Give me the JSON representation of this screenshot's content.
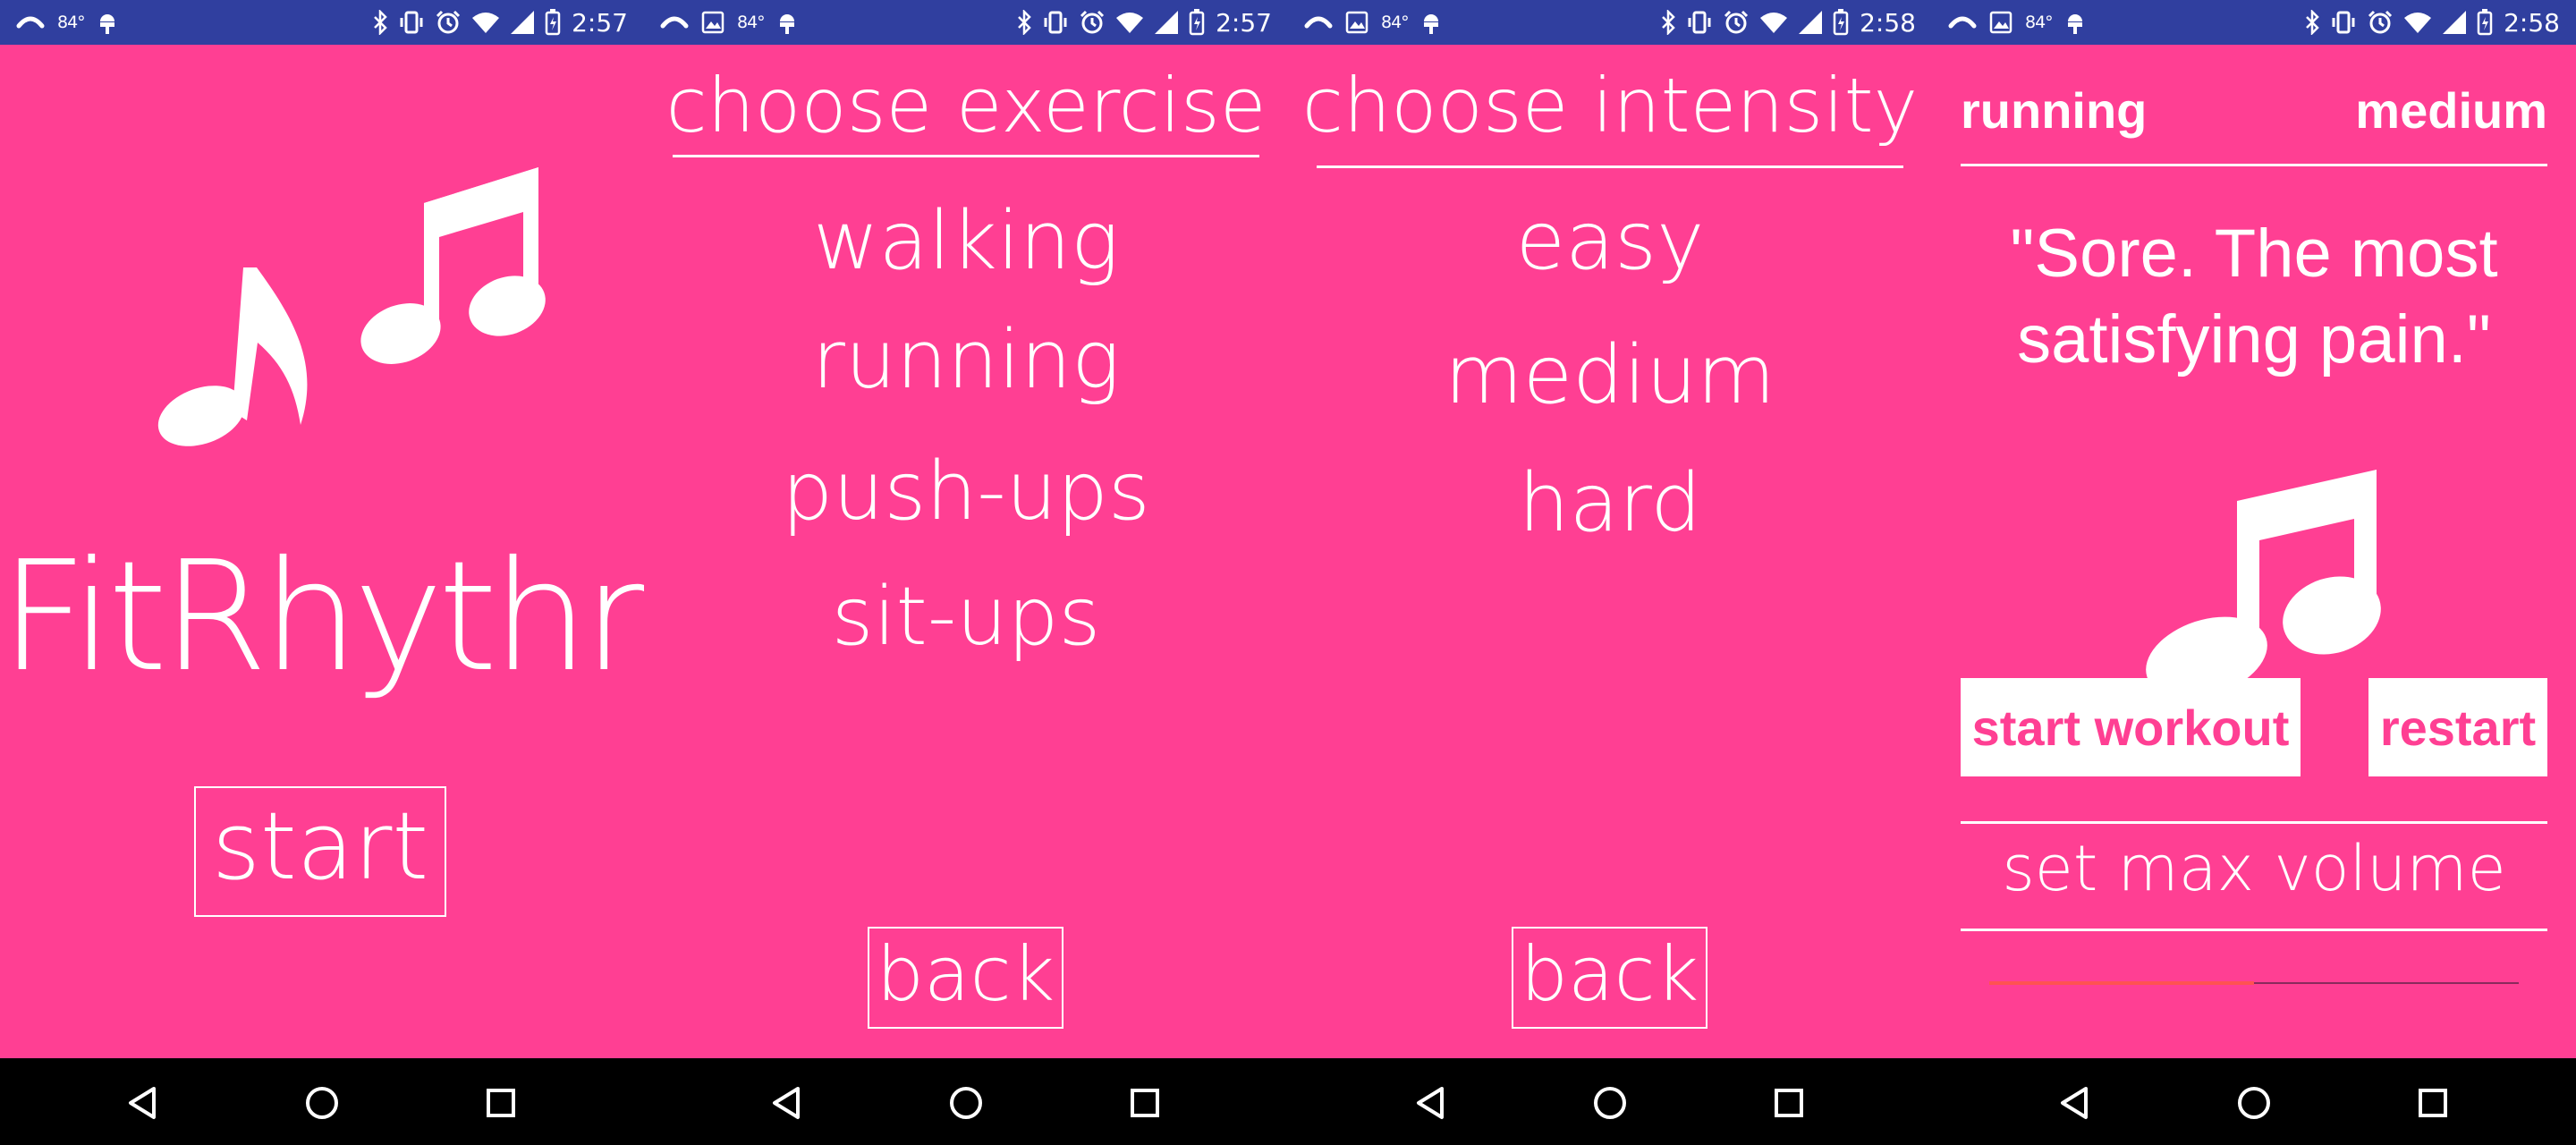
{
  "colors": {
    "background": "#FF3F93",
    "status_bar": "#303F9F",
    "nav_bar": "#000000",
    "foreground": "#FFFFFF"
  },
  "status_bars": [
    {
      "temperature": "84°",
      "time": "2:57"
    },
    {
      "temperature": "84°",
      "time": "2:57"
    },
    {
      "temperature": "84°",
      "time": "2:58"
    },
    {
      "temperature": "84°",
      "time": "2:58"
    }
  ],
  "home": {
    "app_name": "FitRhythm",
    "start_label": "start",
    "icon": "music-notes-icon"
  },
  "exercise": {
    "title": "choose exercise",
    "options": [
      "walking",
      "running",
      "push-ups",
      "sit-ups"
    ],
    "back_label": "back"
  },
  "intensity": {
    "title": "choose intensity",
    "options": [
      "easy",
      "medium",
      "hard"
    ],
    "back_label": "back"
  },
  "workout": {
    "exercise": "running",
    "intensity": "medium",
    "quote_line1": "\"Sore. The most",
    "quote_line2": "satisfying pain.\"",
    "start_workout_label": "start workout",
    "restart_label": "restart",
    "volume_label": "set max volume",
    "volume_level": 0.5,
    "icon": "music-note-icon"
  }
}
